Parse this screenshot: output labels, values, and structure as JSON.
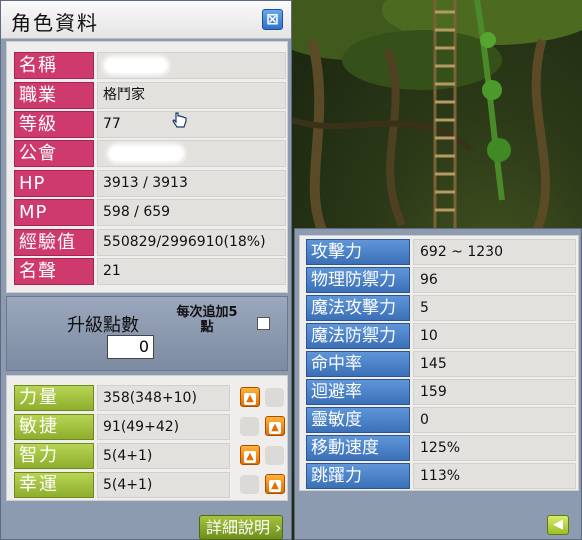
{
  "window": {
    "title": "角色資料",
    "close_glyph": "⊠"
  },
  "info": [
    {
      "label": "名稱",
      "value": "",
      "redacted": true
    },
    {
      "label": "職業",
      "value": "格鬥家"
    },
    {
      "label": "等級",
      "value": "77"
    },
    {
      "label": "公會",
      "value": "",
      "redacted": true
    },
    {
      "label": "HP",
      "value": "3913 / 3913"
    },
    {
      "label": "MP",
      "value": "598 / 659"
    },
    {
      "label": "經驗值",
      "value": "550829/2996910(18%)"
    },
    {
      "label": "名聲",
      "value": "21"
    }
  ],
  "ap": {
    "label": "升級點數",
    "value": "0",
    "auto_assign_label_line1": "每次追加5",
    "auto_assign_label_line2": "點",
    "auto_assign_checked": false
  },
  "stats": [
    {
      "label": "力量",
      "value": "358(348+10)"
    },
    {
      "label": "敏捷",
      "value": "91(49+42)"
    },
    {
      "label": "智力",
      "value": "5(4+1)"
    },
    {
      "label": "幸運",
      "value": "5(4+1)"
    }
  ],
  "detail_button": "詳細說明",
  "detail": [
    {
      "label": "攻擊力",
      "value": "692 ~ 1230"
    },
    {
      "label": "物理防禦力",
      "value": "96"
    },
    {
      "label": "魔法攻擊力",
      "value": "5"
    },
    {
      "label": "魔法防禦力",
      "value": "10"
    },
    {
      "label": "命中率",
      "value": "145"
    },
    {
      "label": "迴避率",
      "value": "159"
    },
    {
      "label": "靈敏度",
      "value": "0"
    },
    {
      "label": "移動速度",
      "value": "125%"
    },
    {
      "label": "跳躍力",
      "value": "113%"
    }
  ],
  "icons": {
    "close": "close-icon",
    "up": "arrow-up-icon",
    "back": "arrow-left-icon",
    "cursor": "hand-cursor-icon"
  },
  "colors": {
    "info_label": "#cf3a6e",
    "stat_label": "#9cbc38",
    "detail_label": "#4a82c8",
    "up_button": "#f08a10"
  }
}
